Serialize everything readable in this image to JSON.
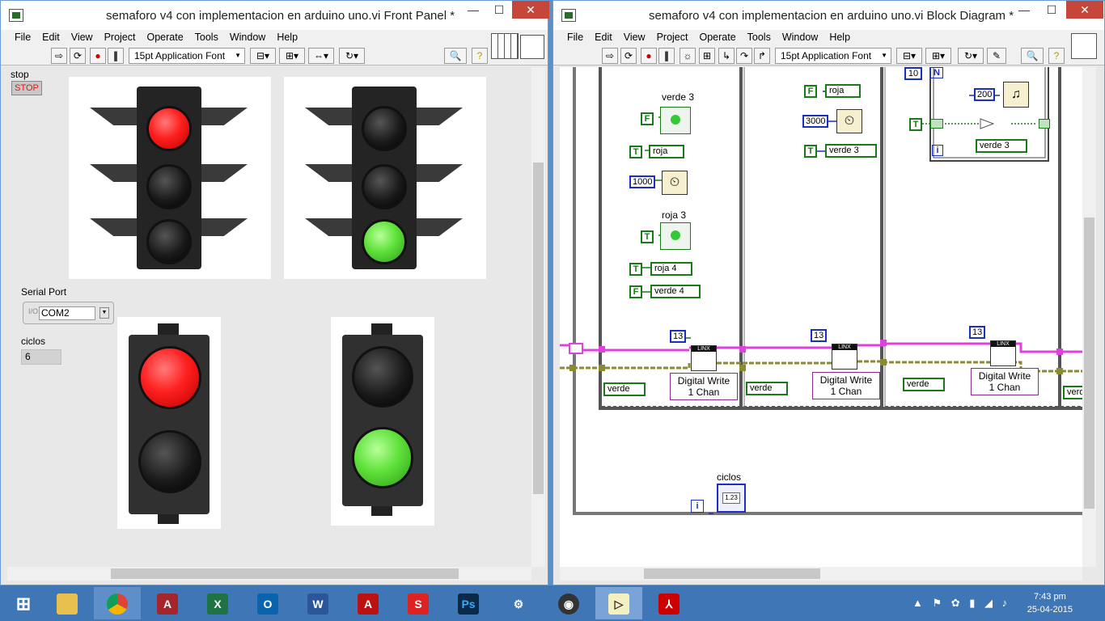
{
  "front_panel": {
    "title": "semaforo v4 con implementacion en arduino uno.vi Front Panel *",
    "menu": [
      "File",
      "Edit",
      "View",
      "Project",
      "Operate",
      "Tools",
      "Window",
      "Help"
    ],
    "font": "15pt Application Font",
    "stop_label": "stop",
    "stop_button": "STOP",
    "serial_label": "Serial Port",
    "serial_value": "COM2",
    "ciclos_label": "ciclos",
    "ciclos_value": "6"
  },
  "block_diagram": {
    "title": "semaforo v4 con implementacion en arduino uno.vi Block Diagram *",
    "menu": [
      "File",
      "Edit",
      "View",
      "Project",
      "Operate",
      "Tools",
      "Window",
      "Help"
    ],
    "font": "15pt Application Font",
    "verde3_label": "verde 3",
    "roja3_label": "roja 3",
    "ciclos_label": "ciclos",
    "const_1000": "1000",
    "const_3000": "3000",
    "const_10": "10",
    "const_200": "200",
    "const_13a": "13",
    "const_13b": "13",
    "const_13c": "13",
    "loop_n": "N",
    "loop_i": "i",
    "loop_i2": "i",
    "bool_f": "F",
    "bool_t": "T",
    "local_roja": "roja",
    "local_roja4": "roja 4",
    "local_verde4": "verde 4",
    "local_verde3": "verde 3",
    "local_verde": "verde",
    "dw_label": "Digital Write 1 Chan",
    "dw_line1": "Digital Write",
    "dw_line2": "1 Chan",
    "linx": "LINX",
    "indicator_123": "1.23"
  },
  "taskbar": {
    "time": "7:43 pm",
    "date": "25-04-2015"
  }
}
